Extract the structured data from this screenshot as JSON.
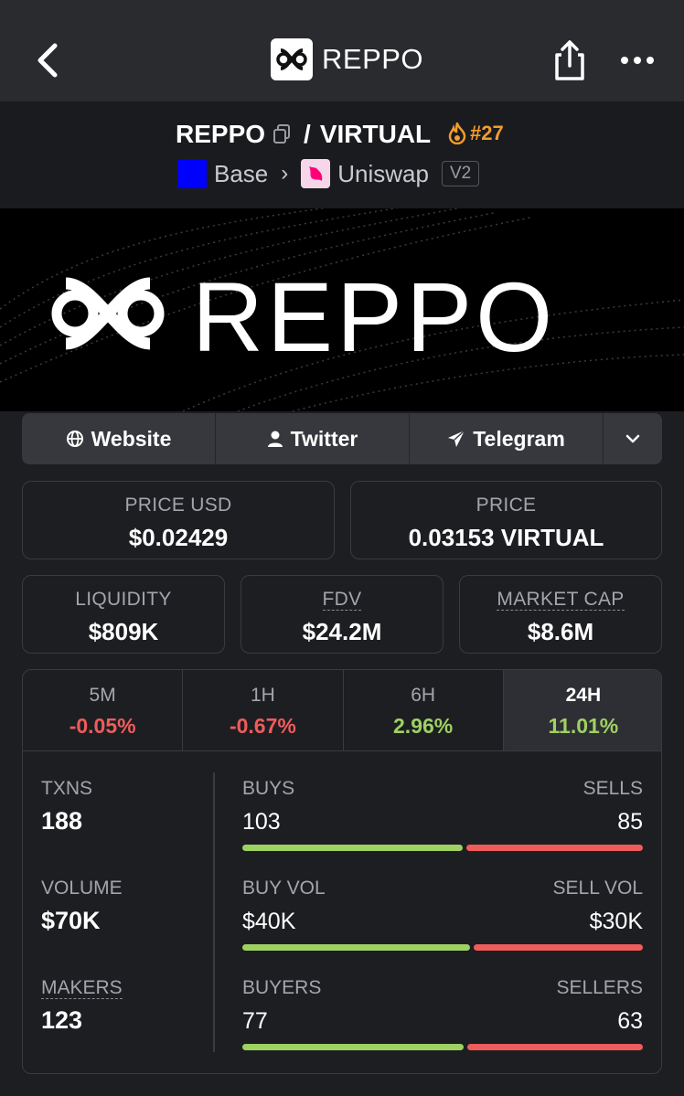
{
  "header": {
    "title": "REPPO",
    "back_icon": "chevron-left-icon",
    "share_icon": "share-icon",
    "more_icon": "more-horizontal-icon"
  },
  "pair": {
    "base": "REPPO",
    "quote": "VIRTUAL",
    "rank": "#27",
    "chain": "Base",
    "dex": "Uniswap",
    "version": "V2"
  },
  "banner": {
    "text": "REPPO"
  },
  "links": {
    "website": "Website",
    "twitter": "Twitter",
    "telegram": "Telegram"
  },
  "prices": {
    "price_usd_label": "PRICE USD",
    "price_usd": "$0.02429",
    "price_label": "PRICE",
    "price": "0.03153 VIRTUAL"
  },
  "market": {
    "liquidity_label": "LIQUIDITY",
    "liquidity": "$809K",
    "fdv_label": "FDV",
    "fdv": "$24.2M",
    "mcap_label": "MARKET CAP",
    "mcap": "$8.6M"
  },
  "timeframes": [
    {
      "label": "5M",
      "change": "-0.05%"
    },
    {
      "label": "1H",
      "change": "-0.67%"
    },
    {
      "label": "6H",
      "change": "2.96%"
    },
    {
      "label": "24H",
      "change": "11.01%"
    }
  ],
  "metrics": {
    "txns_label": "TXNS",
    "txns": "188",
    "volume_label": "VOLUME",
    "volume": "$70K",
    "makers_label": "MAKERS",
    "makers": "123"
  },
  "splits": {
    "buys_label": "BUYS",
    "buys": "103",
    "sells_label": "SELLS",
    "sells": "85",
    "buyvol_label": "BUY VOL",
    "buyvol": "$40K",
    "sellvol_label": "SELL VOL",
    "sellvol": "$30K",
    "buyers_label": "BUYERS",
    "buyers": "77",
    "sellers_label": "SELLERS",
    "sellers": "63"
  },
  "colors": {
    "positive": "#9fd162",
    "negative": "#ee5c5c",
    "rank": "#f39c2c",
    "base_chain": "#0000ff"
  }
}
